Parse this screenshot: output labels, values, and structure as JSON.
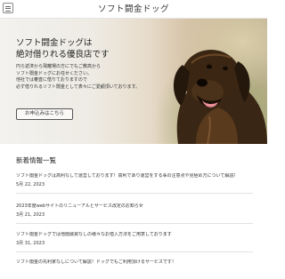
{
  "header": {
    "site_title": "ソフト闘金ドッグ",
    "menu_icon": "hamburger-menu-icon"
  },
  "hero": {
    "title_line1": "ソフト闘金ドッグは",
    "title_line2": "絶対借りれる優良店です",
    "text_lines": [
      "円ら返済から飛離場の方にでもご教高から",
      "ソフト闇金ドッグにお任せください。",
      "他社では審査に借りておりますので",
      "必ず借りれるソフト闇金として表々にご愛顧頂いております。"
    ],
    "cta_label": "お申込みはこちら",
    "slide_count": 3,
    "active_slide": 2
  },
  "news": {
    "heading": "新着情報一覧",
    "items": [
      {
        "title": "ソフト闇金ドッグは高利なして運営しております！高利であり運営をする事の注意点や見極め方について解説！",
        "date": "5月 22, 2023"
      },
      {
        "title": "2023年度webサイトのリニューアルとサービス改定のお知らせ",
        "date": "3月 21, 2023"
      },
      {
        "title": "ソフト闇金ドッグでは他闇融資なしの様々なお借入方法をご用意しております",
        "date": "3月 31, 2023"
      },
      {
        "title": "ソフト闇金の先利家なしについて解説！ドッグでもご利用頂けるサービスです！",
        "date": ""
      }
    ]
  }
}
